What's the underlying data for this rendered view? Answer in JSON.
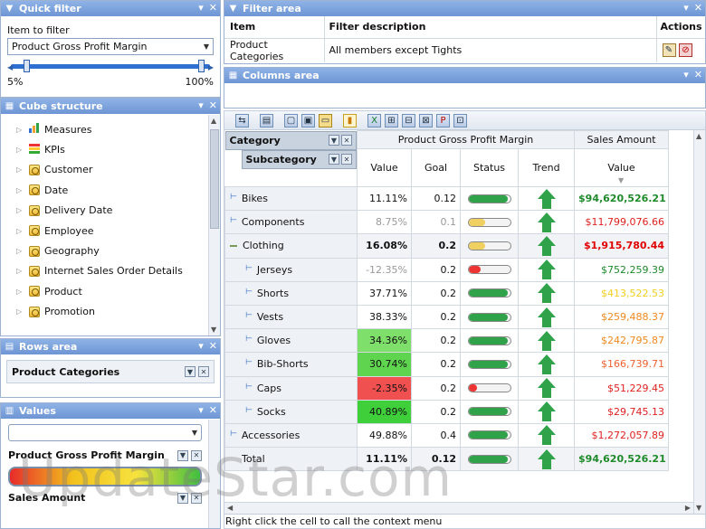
{
  "quick_filter": {
    "title": "Quick filter",
    "item_label": "Item to filter",
    "item_value": "Product Gross Profit Margin",
    "range_min": "5%",
    "range_max": "100%"
  },
  "cube_structure": {
    "title": "Cube structure",
    "items": [
      "Measures",
      "KPIs",
      "Customer",
      "Date",
      "Delivery Date",
      "Employee",
      "Geography",
      "Internet Sales Order Details",
      "Product",
      "Promotion"
    ]
  },
  "rows_area": {
    "title": "Rows area",
    "item": "Product Categories"
  },
  "values_area": {
    "title": "Values",
    "item1": "Product Gross Profit Margin",
    "item2": "Sales Amount"
  },
  "filter_area": {
    "title": "Filter area",
    "headers": {
      "item": "Item",
      "desc": "Filter description",
      "actions": "Actions"
    },
    "row": {
      "item": "Product Categories",
      "desc": "All members except Tights"
    }
  },
  "columns_area": {
    "title": "Columns area"
  },
  "grid": {
    "measure1": "Product Gross Profit Margin",
    "measure2": "Sales Amount",
    "category_label": "Category",
    "subcategory_label": "Subcategory",
    "cols": {
      "value": "Value",
      "goal": "Goal",
      "status": "Status",
      "trend": "Trend",
      "value2": "Value"
    },
    "rows": [
      {
        "label": "Bikes",
        "value": "11.11%",
        "goal": "0.12",
        "sales": "$94,620,526.21"
      },
      {
        "label": "Components",
        "value": "8.75%",
        "goal": "0.1",
        "sales": "$11,799,076.66"
      },
      {
        "label": "Clothing",
        "value": "16.08%",
        "goal": "0.2",
        "sales": "$1,915,780.44"
      },
      {
        "label": "Jerseys",
        "value": "-12.35%",
        "goal": "0.2",
        "sales": "$752,259.39"
      },
      {
        "label": "Shorts",
        "value": "37.71%",
        "goal": "0.2",
        "sales": "$413,522.53"
      },
      {
        "label": "Vests",
        "value": "38.33%",
        "goal": "0.2",
        "sales": "$259,488.37"
      },
      {
        "label": "Gloves",
        "value": "34.36%",
        "goal": "0.2",
        "sales": "$242,795.87"
      },
      {
        "label": "Bib-Shorts",
        "value": "30.74%",
        "goal": "0.2",
        "sales": "$166,739.71"
      },
      {
        "label": "Caps",
        "value": "-2.35%",
        "goal": "0.2",
        "sales": "$51,229.45"
      },
      {
        "label": "Socks",
        "value": "40.89%",
        "goal": "0.2",
        "sales": "$29,745.13"
      },
      {
        "label": "Accessories",
        "value": "49.88%",
        "goal": "0.4",
        "sales": "$1,272,057.89"
      },
      {
        "label": "Total",
        "value": "11.11%",
        "goal": "0.12",
        "sales": "$94,620,526.21"
      }
    ]
  },
  "status_bar": "Right click the cell to call the context menu",
  "watermark": "UpdateStar.com"
}
